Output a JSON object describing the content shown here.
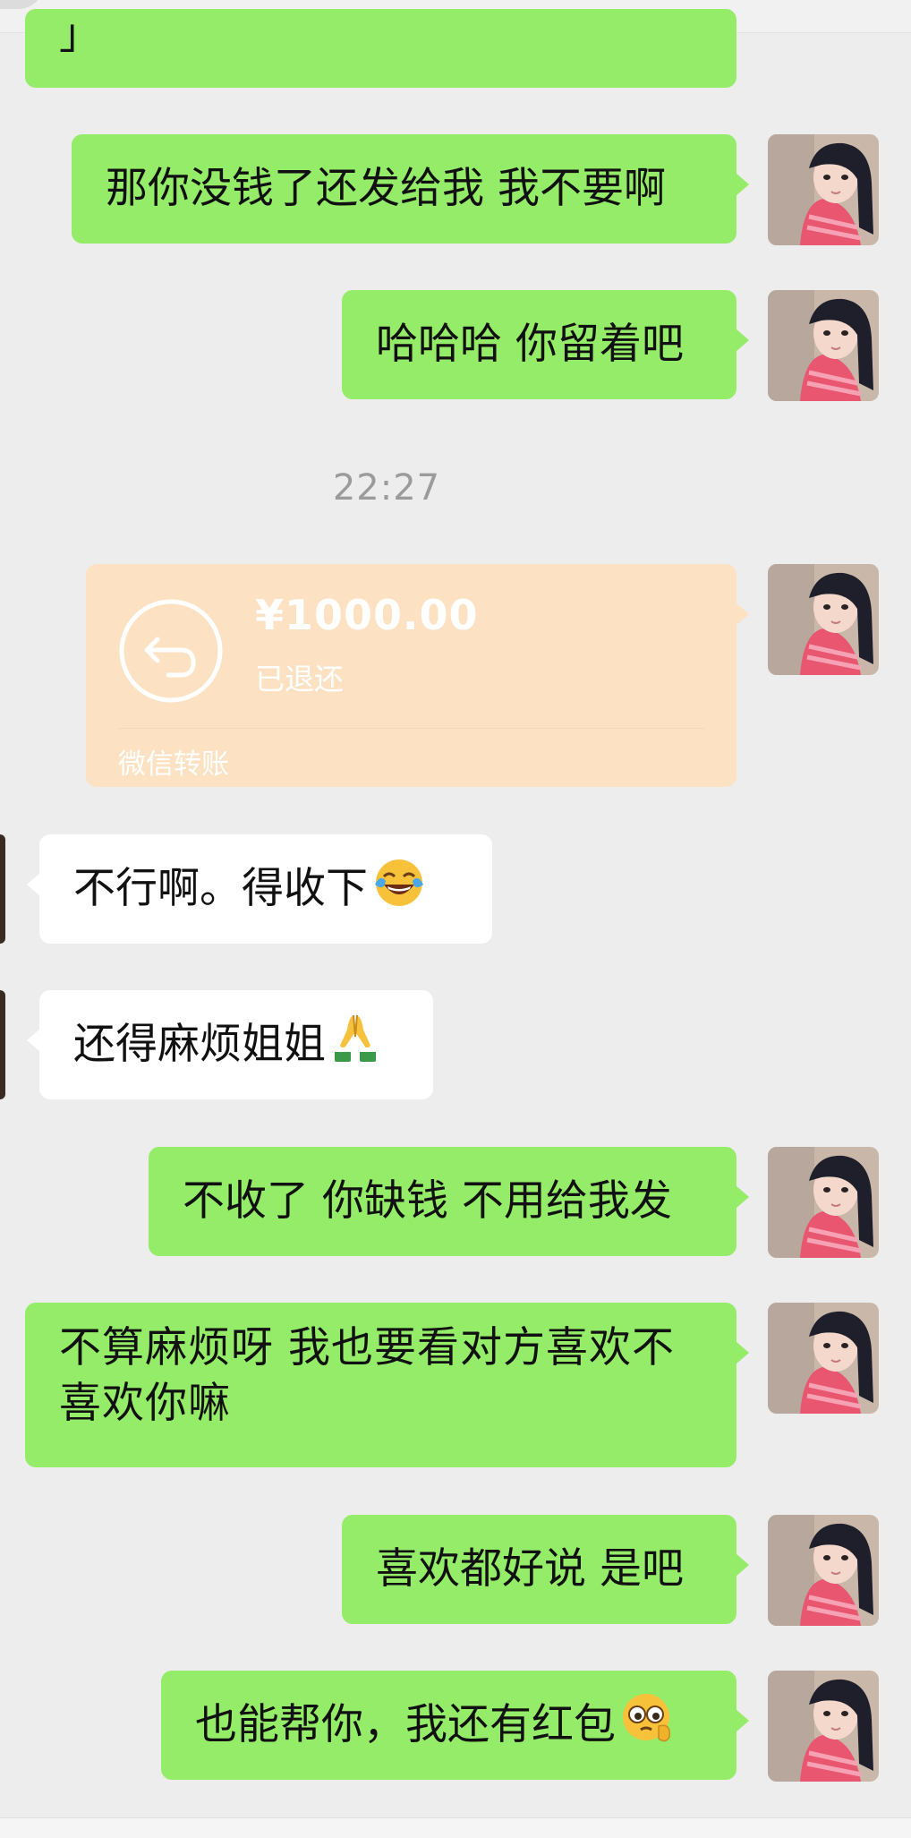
{
  "messages": {
    "m0": "」",
    "m1": "那你没钱了还发给我 我不要啊",
    "m2": "哈哈哈 你留着吧",
    "timestamp": "22:27",
    "transfer": {
      "amount": "¥1000.00",
      "status": "已退还",
      "label": "微信转账",
      "icon": "return-arrow-icon"
    },
    "m4": "不行啊。得收下",
    "m4_emoji": "tears-of-joy-emoji",
    "m5": "还得麻烦姐姐",
    "m5_emoji": "folded-hands-emoji",
    "m6": "不收了 你缺钱 不用给我发",
    "m7": "不算麻烦呀 我也要看对方喜欢不喜欢你嘛",
    "m8": "喜欢都好说 是吧",
    "m9": "也能帮你，我还有红包",
    "m9_emoji": "pleading-face-emoji"
  },
  "colors": {
    "sent_bubble": "#95ec69",
    "received_bubble": "#ffffff",
    "transfer_card": "#fce2c3",
    "background": "#ededed"
  }
}
